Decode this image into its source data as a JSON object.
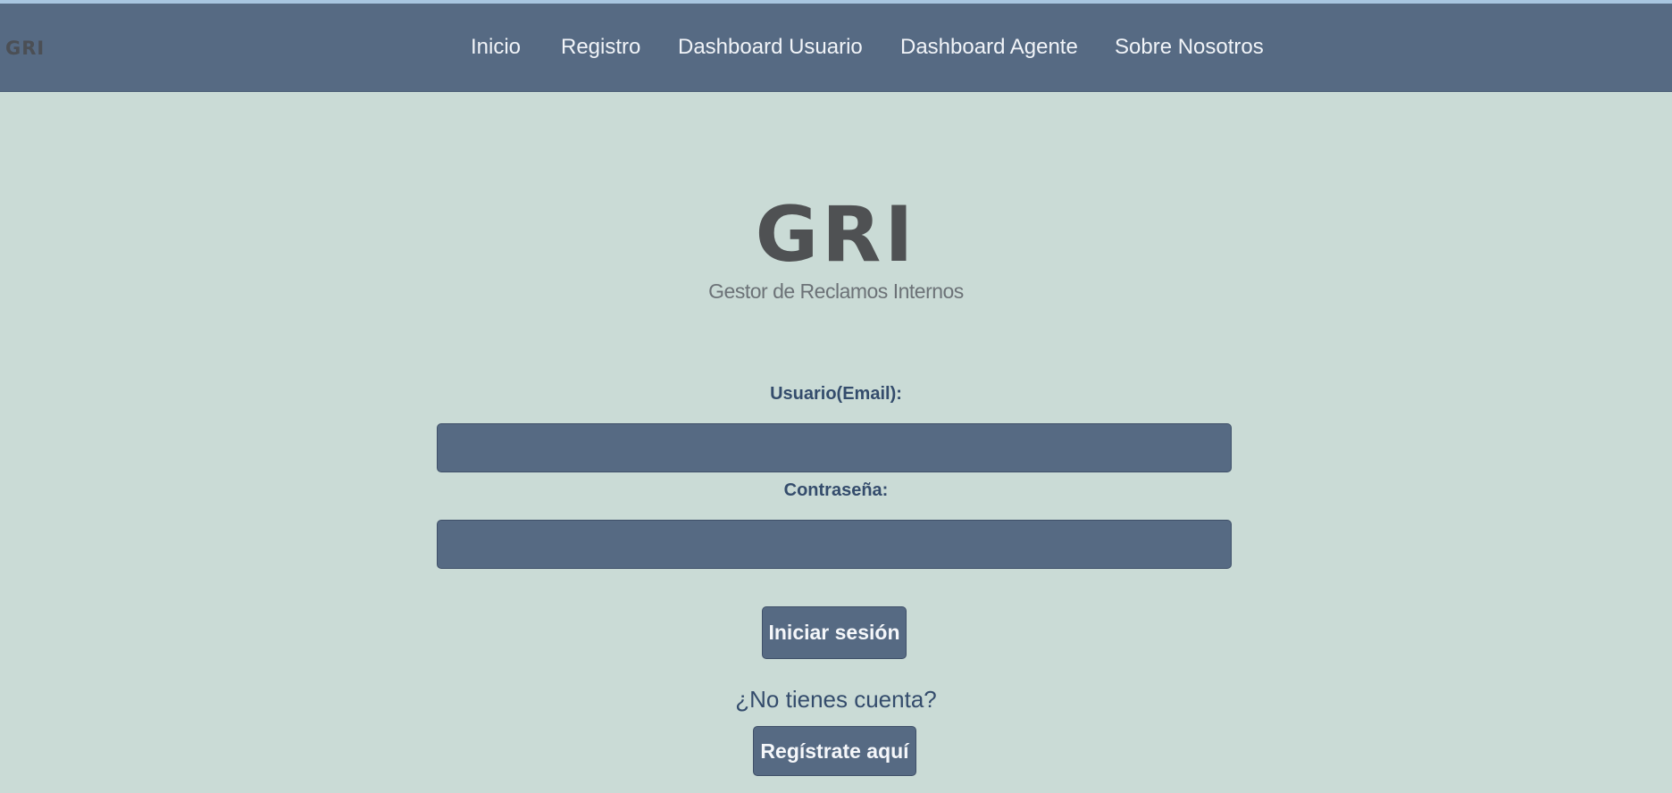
{
  "navbar": {
    "logo": "GRI",
    "links": [
      {
        "label": "Inicio"
      },
      {
        "label": "Registro"
      },
      {
        "label": "Dashboard Usuario"
      },
      {
        "label": "Dashboard Agente"
      },
      {
        "label": "Sobre Nosotros"
      }
    ]
  },
  "brand": {
    "title": "GRI",
    "subtitle": "Gestor de Reclamos Internos"
  },
  "form": {
    "email_label": "Usuario(Email):",
    "email_value": "",
    "password_label": "Contraseña:",
    "password_value": "",
    "submit_label": "Iniciar sesión",
    "signup_question": "¿No tienes cuenta?",
    "signup_label": "Regístrate aquí"
  },
  "colors": {
    "background": "#cadbd6",
    "navbar": "#566a83",
    "accent_text": "#344c6c"
  }
}
